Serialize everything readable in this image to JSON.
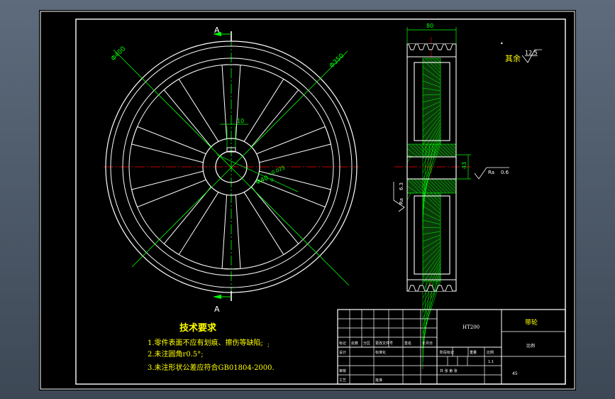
{
  "colors": {
    "background": "#000000",
    "frame": "#ffffff",
    "dimension": "#00ff00",
    "centerline": "#ff0000",
    "hatch": "#00ff00",
    "note_text": "#ffff00",
    "table_text": "#ffffff"
  },
  "section_marks": {
    "top": "A",
    "bottom": "A"
  },
  "front_view": {
    "dim_outer": "Φ400",
    "dim_inner": "Φ350",
    "dim_keyway": "10",
    "dim_bore": "Φ40",
    "tol_upper": "+0.025",
    "tol_lower": "0"
  },
  "section_view": {
    "dim_width": "80",
    "dim_key_depth": "43",
    "roughness_left_label": "Ra",
    "roughness_left_value": "6.3",
    "roughness_right_label": "Ra",
    "roughness_right_value": "0.6"
  },
  "roughness_note": {
    "label": "其余",
    "value": "12.5"
  },
  "tech_requirements": {
    "title": "技术要求",
    "items": [
      "1.零件表面不应有划痕、擦伤等缺陷;",
      "2.未注圆角r0.5°;",
      "3.未注形状公差应符合GB01804-2000."
    ],
    "stray_mark": ";"
  },
  "title_block": {
    "material": "HT200",
    "part_name": "带轮",
    "unit": "比例",
    "header_cells": [
      "标记",
      "处数",
      "分区",
      "更改文件号",
      "签名",
      "年月日"
    ],
    "review_cells": [
      "设计",
      "标准化",
      "审核",
      "工艺",
      "批准"
    ],
    "stage_cells": [
      "阶段标记",
      "重量",
      "比例"
    ],
    "sheet_text": "共 张 第 张",
    "scale_value": "1:1",
    "weight_value": "",
    "sheet_no": "45"
  }
}
